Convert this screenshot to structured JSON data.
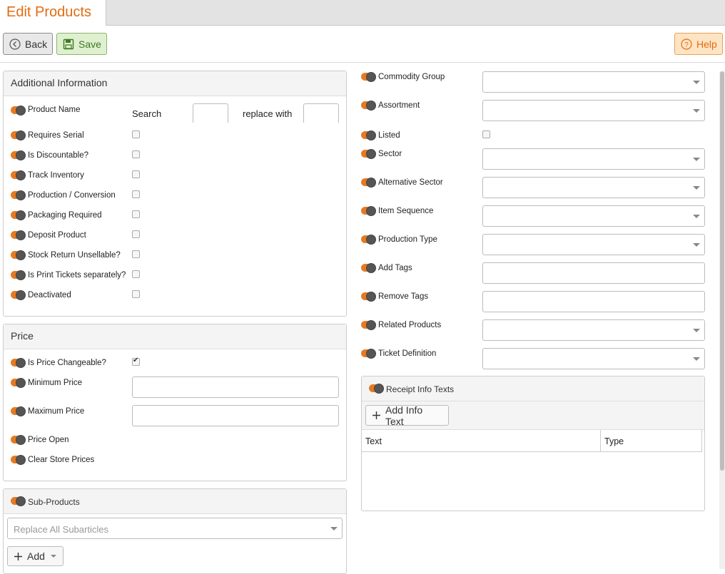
{
  "tab": {
    "title": "Edit Products"
  },
  "toolbar": {
    "back_label": "Back",
    "save_label": "Save",
    "help_label": "Help"
  },
  "additional_info": {
    "title": "Additional Information",
    "product_name": {
      "label": "Product Name",
      "search_label": "Search",
      "replace_label": "replace with",
      "search_value": "",
      "replace_value": ""
    },
    "checkboxes": [
      {
        "label": "Requires Serial",
        "checked": false
      },
      {
        "label": "Is Discountable?",
        "checked": false
      },
      {
        "label": "Track Inventory",
        "checked": false
      },
      {
        "label": "Production / Conversion",
        "checked": false
      },
      {
        "label": "Packaging Required",
        "checked": false
      },
      {
        "label": "Deposit Product",
        "checked": false
      },
      {
        "label": "Stock Return Unsellable?",
        "checked": false
      },
      {
        "label": "Is Print Tickets separately?",
        "checked": false
      },
      {
        "label": "Deactivated",
        "checked": false
      }
    ]
  },
  "price": {
    "title": "Price",
    "is_price_changeable": {
      "label": "Is Price Changeable?",
      "checked": true
    },
    "minimum_price": {
      "label": "Minimum Price",
      "value": ""
    },
    "maximum_price": {
      "label": "Maximum Price",
      "value": ""
    },
    "price_open": {
      "label": "Price Open"
    },
    "clear_store_prices": {
      "label": "Clear Store Prices"
    }
  },
  "subproducts": {
    "title": "Sub-Products",
    "select_placeholder": "Replace All Subarticles",
    "add_label": "Add"
  },
  "right_fields": [
    {
      "label": "Commodity Group",
      "kind": "select"
    },
    {
      "label": "Assortment",
      "kind": "select"
    },
    {
      "label": "Listed",
      "kind": "checkbox"
    },
    {
      "label": "Sector",
      "kind": "select"
    },
    {
      "label": "Alternative Sector",
      "kind": "select"
    },
    {
      "label": "Item Sequence",
      "kind": "select"
    },
    {
      "label": "Production Type",
      "kind": "select"
    },
    {
      "label": "Add Tags",
      "kind": "input"
    },
    {
      "label": "Remove Tags",
      "kind": "input"
    },
    {
      "label": "Related Products",
      "kind": "select"
    },
    {
      "label": "Ticket Definition",
      "kind": "select"
    }
  ],
  "receipt_info": {
    "title": "Receipt Info Texts",
    "add_label": "Add Info Text",
    "columns": [
      "Text",
      "Type"
    ]
  },
  "colors": {
    "accent": "#e56b10",
    "toggle": "#e57a22",
    "save_bg": "#dff0d0",
    "help_bg": "#fde4c4"
  }
}
